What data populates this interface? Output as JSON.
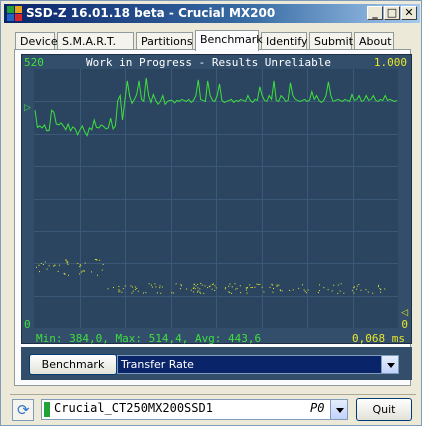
{
  "window": {
    "title": "SSD-Z 16.01.18 beta - Crucial MX200",
    "buttons": {
      "minimize": "_",
      "maximize": "□",
      "close": "✕"
    }
  },
  "tabs": [
    {
      "label": "Device",
      "active": false
    },
    {
      "label": "S.M.A.R.T.",
      "active": false
    },
    {
      "label": "Partitions",
      "active": false
    },
    {
      "label": "Benchmark",
      "active": true
    },
    {
      "label": "Identify",
      "active": false
    },
    {
      "label": "Submit",
      "active": false
    },
    {
      "label": "About",
      "active": false
    }
  ],
  "benchmark": {
    "y_max_left": "520",
    "y_max_right": "1.000",
    "banner": "Work in Progress - Results Unreliable",
    "y_min_left": "0",
    "y_min_right": "0",
    "stats": "Min: 384,0, Max: 514,4, Avg: 443,6",
    "latency": "0,068 ms",
    "button_label": "Benchmark",
    "mode": "Transfer Rate"
  },
  "chart_data": {
    "type": "line",
    "ylim": [
      0,
      520
    ],
    "y2lim": [
      0,
      1.0
    ],
    "series": [
      {
        "color": "#3ee03e",
        "values": [
          440,
          405,
          408,
          404,
          410,
          398,
          399,
          440,
          436,
          412,
          410,
          414,
          408,
          400,
          412,
          398,
          406,
          402,
          390,
          400,
          408,
          396,
          388,
          404,
          400,
          420,
          405,
          404,
          410,
          407,
          402,
          404,
          424,
          402,
          408,
          460,
          470,
          420,
          460,
          500,
          470,
          454,
          462,
          472,
          500,
          462,
          458,
          506,
          470,
          456,
          472,
          460,
          452,
          458,
          470,
          452,
          458,
          460,
          460,
          455,
          460,
          458,
          462,
          460,
          458,
          462,
          456,
          460,
          470,
          502,
          462,
          460,
          458,
          500,
          470,
          460,
          458,
          470,
          494,
          460,
          456,
          458,
          460,
          462,
          456,
          460,
          458,
          462,
          460,
          458,
          470,
          460,
          456,
          462,
          460,
          488,
          470,
          460,
          458,
          470,
          462,
          500,
          460,
          458,
          470,
          465,
          458,
          460,
          496,
          470,
          462,
          460,
          458,
          460,
          462,
          458,
          460,
          478,
          462,
          470,
          460,
          456,
          460,
          470,
          498,
          470,
          458,
          460,
          462,
          460,
          458,
          462,
          460,
          458,
          472,
          460,
          462,
          470,
          458,
          460,
          470,
          460,
          462,
          470,
          460,
          458,
          462,
          460,
          470,
          460,
          462,
          460,
          458,
          460
        ]
      }
    ]
  },
  "drive": {
    "name": "Crucial_CT250MX200SSD1",
    "port": "P0"
  },
  "quit_label": "Quit",
  "colors": {
    "chart_bg": "#324e6b",
    "throughput": "#3ee03e",
    "latency": "#e8e82a",
    "selected_mode_bg": "#0a246a"
  }
}
